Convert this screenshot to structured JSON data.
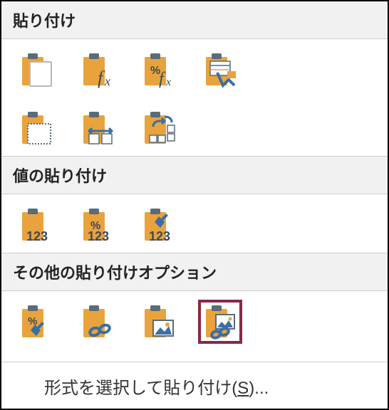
{
  "sections": {
    "paste": {
      "title": "貼り付け"
    },
    "values": {
      "title": "値の貼り付け"
    },
    "other": {
      "title": "その他の貼り付けオプション"
    }
  },
  "footer": {
    "text_before": "形式を選択して貼り付け(",
    "hotkey": "S",
    "text_after": ")..."
  },
  "icons": {
    "clipboard_color": "#e8a33d",
    "clipboard_clip": "#5a6b7a",
    "accent_blue": "#3a6ea5",
    "text_dark": "#3b4a57"
  }
}
